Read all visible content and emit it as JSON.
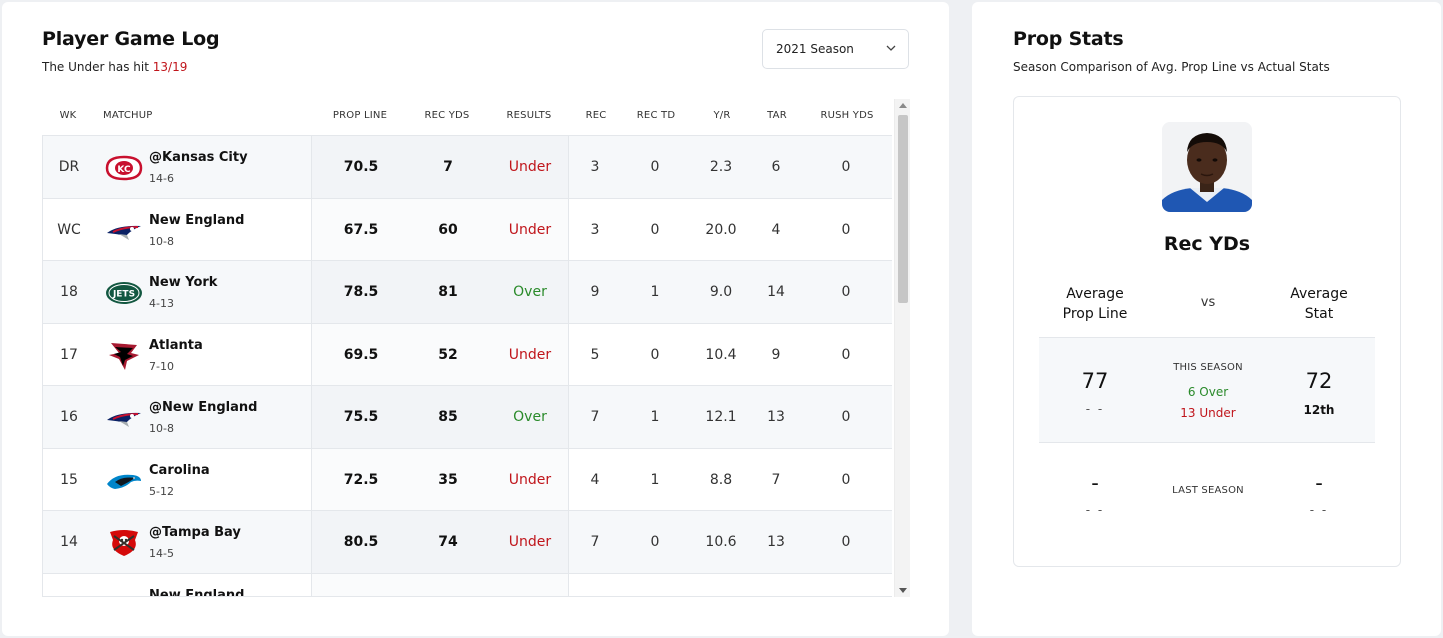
{
  "game_log": {
    "title": "Player Game Log",
    "subtitle_prefix": "The Under has hit",
    "subtitle_value": "13/19",
    "season_select": "2021 Season",
    "columns": [
      "WK",
      "MATCHUP",
      "PROP LINE",
      "REC YDS",
      "RESULTS",
      "REC",
      "REC TD",
      "Y/R",
      "TAR",
      "RUSH YDS"
    ],
    "rows": [
      {
        "wk": "DR",
        "team": "@Kansas City",
        "record": "14-6",
        "logo": "chiefs-logo",
        "prop_line": "70.5",
        "rec_yds": "7",
        "result": "Under",
        "rec": "3",
        "rec_td": "0",
        "yr": "2.3",
        "tar": "6",
        "rush_yds": "0"
      },
      {
        "wk": "WC",
        "team": "New England",
        "record": "10-8",
        "logo": "patriots-logo",
        "prop_line": "67.5",
        "rec_yds": "60",
        "result": "Under",
        "rec": "3",
        "rec_td": "0",
        "yr": "20.0",
        "tar": "4",
        "rush_yds": "0"
      },
      {
        "wk": "18",
        "team": "New York",
        "record": "4-13",
        "logo": "jets-logo",
        "prop_line": "78.5",
        "rec_yds": "81",
        "result": "Over",
        "rec": "9",
        "rec_td": "1",
        "yr": "9.0",
        "tar": "14",
        "rush_yds": "0"
      },
      {
        "wk": "17",
        "team": "Atlanta",
        "record": "7-10",
        "logo": "falcons-logo",
        "prop_line": "69.5",
        "rec_yds": "52",
        "result": "Under",
        "rec": "5",
        "rec_td": "0",
        "yr": "10.4",
        "tar": "9",
        "rush_yds": "0"
      },
      {
        "wk": "16",
        "team": "@New England",
        "record": "10-8",
        "logo": "patriots-logo",
        "prop_line": "75.5",
        "rec_yds": "85",
        "result": "Over",
        "rec": "7",
        "rec_td": "1",
        "yr": "12.1",
        "tar": "13",
        "rush_yds": "0"
      },
      {
        "wk": "15",
        "team": "Carolina",
        "record": "5-12",
        "logo": "panthers-logo",
        "prop_line": "72.5",
        "rec_yds": "35",
        "result": "Under",
        "rec": "4",
        "rec_td": "1",
        "yr": "8.8",
        "tar": "7",
        "rush_yds": "0"
      },
      {
        "wk": "14",
        "team": "@Tampa Bay",
        "record": "14-5",
        "logo": "buccaneers-logo",
        "prop_line": "80.5",
        "rec_yds": "74",
        "result": "Under",
        "rec": "7",
        "rec_td": "0",
        "yr": "10.6",
        "tar": "13",
        "rush_yds": "0"
      },
      {
        "wk": "",
        "team": "New England",
        "record": "",
        "logo": "patriots-logo",
        "prop_line": "",
        "rec_yds": "",
        "result": "",
        "rec": "",
        "rec_td": "",
        "yr": "",
        "tar": "",
        "rush_yds": ""
      }
    ]
  },
  "prop_stats": {
    "title": "Prop Stats",
    "subtitle": "Season Comparison of Avg. Prop Line vs Actual Stats",
    "stat_name": "Rec YDs",
    "left_head_1": "Average",
    "left_head_2": "Prop Line",
    "vs": "vs",
    "right_head_1": "Average",
    "right_head_2": "Stat",
    "this_season": {
      "label": "THIS SEASON",
      "avg_prop_line": "77",
      "avg_prop_line_sub": "- -",
      "over": "6 Over",
      "under": "13 Under",
      "avg_stat": "72",
      "avg_stat_rank": "12th"
    },
    "last_season": {
      "label": "LAST SEASON",
      "avg_prop_line": "-",
      "avg_prop_line_sub": "- -",
      "avg_stat": "-",
      "avg_stat_sub": "- -"
    }
  },
  "colors": {
    "under": "#c0151b",
    "over": "#2a8a2a"
  }
}
